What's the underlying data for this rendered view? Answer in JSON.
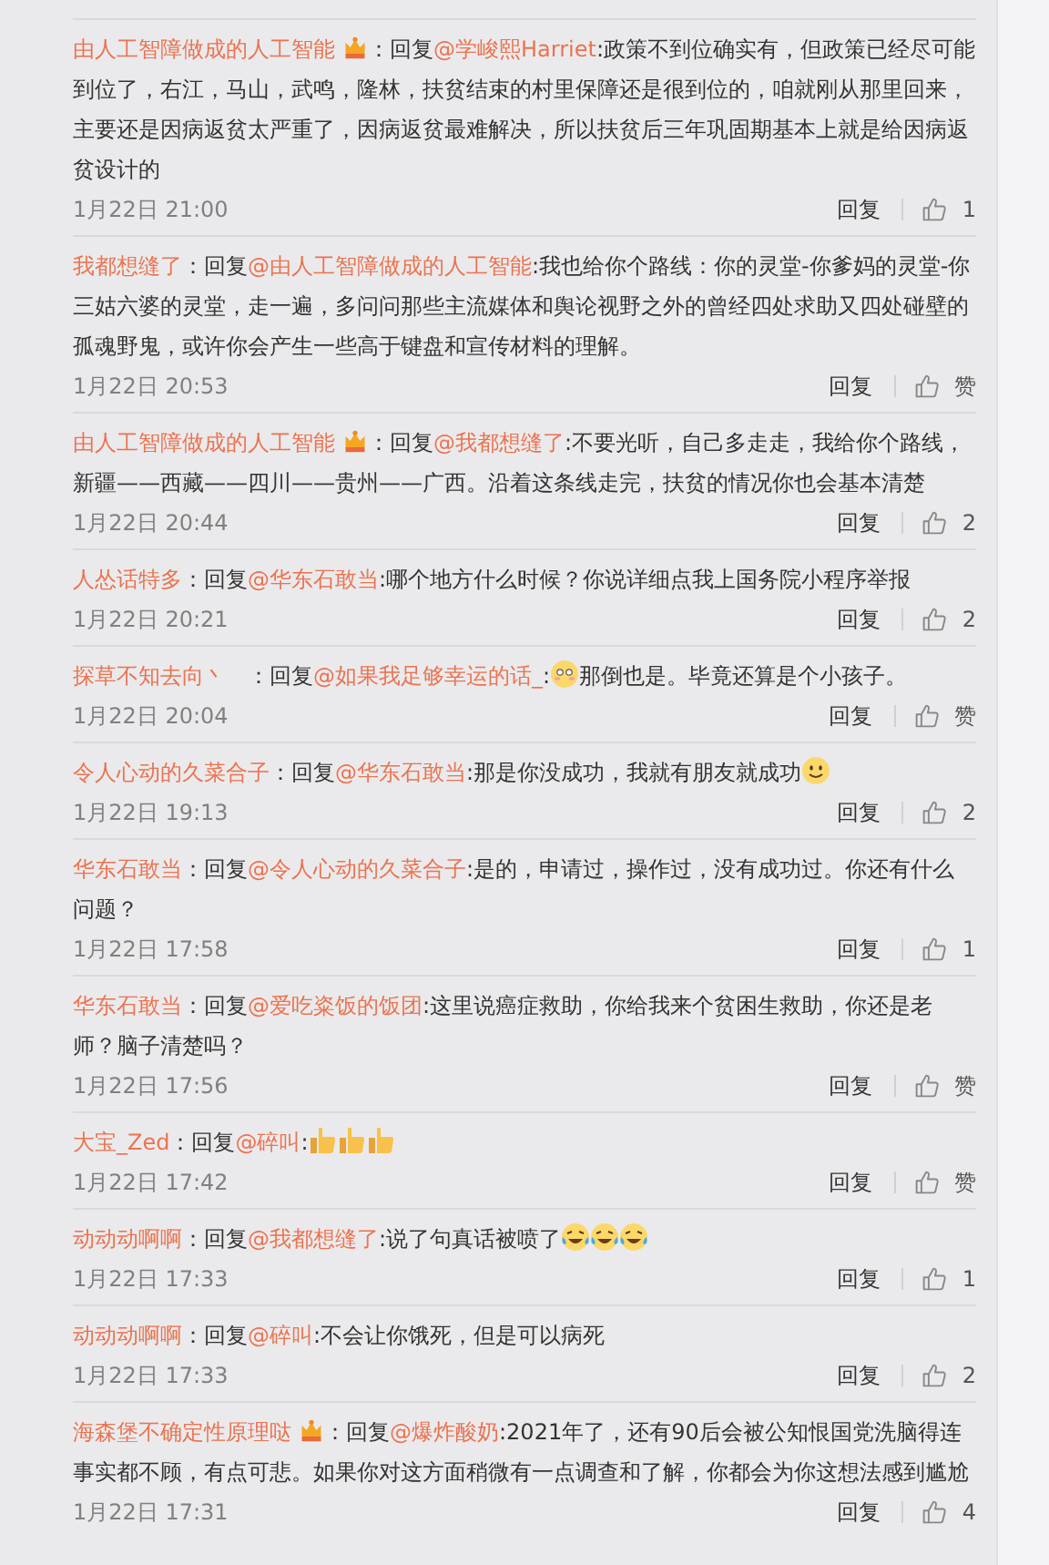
{
  "comments": [
    {
      "user": "由人工智障做成的人工智能",
      "crown_badge": true,
      "reply_label": "：回复",
      "target": "@学峻熙Harriet",
      "body": [
        {
          "kind": "text",
          "text": ":政策不到位确实有，但政策已经尽可能到位了，右江，马山，武鸣，隆林，扶贫结束的村里保障还是很到位的，咱就刚从那里回来，主要还是因病返贫太严重了，因病返贫最难解决，所以扶贫后三年巩固期基本上就是给因病返贫设计的"
        }
      ],
      "time": "1月22日 21:00",
      "reply": "回复",
      "likes": "1"
    },
    {
      "user": "我都想缝了",
      "crown_badge": false,
      "reply_label": "：回复",
      "target": "@由人工智障做成的人工智能",
      "body": [
        {
          "kind": "text",
          "text": ":我也给你个路线：你的灵堂-你爹妈的灵堂-你三姑六婆的灵堂，走一遍，多问问那些主流媒体和舆论视野之外的曾经四处求助又四处碰壁的孤魂野鬼，或许你会产生一些高于键盘和宣传材料的理解。"
        }
      ],
      "time": "1月22日 20:53",
      "reply": "回复",
      "likes": "赞"
    },
    {
      "user": "由人工智障做成的人工智能",
      "crown_badge": true,
      "reply_label": "：回复",
      "target": "@我都想缝了",
      "body": [
        {
          "kind": "text",
          "text": ":不要光听，自己多走走，我给你个路线，新疆——西藏——四川——贵州——广西。沿着这条线走完，扶贫的情况你也会基本清楚"
        }
      ],
      "time": "1月22日 20:44",
      "reply": "回复",
      "likes": "2"
    },
    {
      "user": "人怂话特多",
      "crown_badge": false,
      "reply_label": "：回复",
      "target": "@华东石敢当",
      "body": [
        {
          "kind": "text",
          "text": ":哪个地方什么时候？你说详细点我上国务院小程序举报"
        }
      ],
      "time": "1月22日 20:21",
      "reply": "回复",
      "likes": "2"
    },
    {
      "user": "探草不知去向丶",
      "crown_badge": false,
      "reply_label": "　：回复",
      "target": "@如果我足够幸运的话_",
      "body": [
        {
          "kind": "text",
          "text": ":"
        },
        {
          "kind": "shy"
        },
        {
          "kind": "text",
          "text": "那倒也是。毕竟还算是个小孩子。"
        }
      ],
      "time": "1月22日 20:04",
      "reply": "回复",
      "likes": "赞"
    },
    {
      "user": "令人心动的久菜合子",
      "crown_badge": false,
      "reply_label": "：回复",
      "target": "@华东石敢当",
      "body": [
        {
          "kind": "text",
          "text": ":那是你没成功，我就有朋友就成功"
        },
        {
          "kind": "smile"
        }
      ],
      "time": "1月22日 19:13",
      "reply": "回复",
      "likes": "2"
    },
    {
      "user": "华东石敢当",
      "crown_badge": false,
      "reply_label": "：回复",
      "target": "@令人心动的久菜合子",
      "body": [
        {
          "kind": "text",
          "text": ":是的，申请过，操作过，没有成功过。你还有什么问题？"
        }
      ],
      "time": "1月22日 17:58",
      "reply": "回复",
      "likes": "1"
    },
    {
      "user": "华东石敢当",
      "crown_badge": false,
      "reply_label": "：回复",
      "target": "@爱吃粢饭的饭团",
      "body": [
        {
          "kind": "text",
          "text": ":这里说癌症救助，你给我来个贫困生救助，你还是老师？脑子清楚吗？"
        }
      ],
      "time": "1月22日 17:56",
      "reply": "回复",
      "likes": "赞"
    },
    {
      "user": "大宝_Zed",
      "crown_badge": false,
      "reply_label": "：回复",
      "target": "@碎叫",
      "body": [
        {
          "kind": "text",
          "text": ":"
        },
        {
          "kind": "thumbsup"
        },
        {
          "kind": "thumbsup"
        },
        {
          "kind": "thumbsup"
        }
      ],
      "time": "1月22日 17:42",
      "reply": "回复",
      "likes": "赞"
    },
    {
      "user": "动动动啊啊",
      "crown_badge": false,
      "reply_label": "：回复",
      "target": "@我都想缝了",
      "body": [
        {
          "kind": "text",
          "text": ":说了句真话被喷了"
        },
        {
          "kind": "laughcry"
        },
        {
          "kind": "laughcry"
        },
        {
          "kind": "laughcry"
        }
      ],
      "time": "1月22日 17:33",
      "reply": "回复",
      "likes": "1"
    },
    {
      "user": "动动动啊啊",
      "crown_badge": false,
      "reply_label": "：回复",
      "target": "@碎叫",
      "body": [
        {
          "kind": "text",
          "text": ":不会让你饿死，但是可以病死"
        }
      ],
      "time": "1月22日 17:33",
      "reply": "回复",
      "likes": "2"
    },
    {
      "user": "海森堡不确定性原理哒",
      "crown_badge": true,
      "reply_label": "：回复",
      "target": "@爆炸酸奶",
      "body": [
        {
          "kind": "text",
          "text": ":2021年了，还有90后会被公知恨国党洗脑得连事实都不顾，有点可悲。如果你对这方面稍微有一点调查和了解，你都会为你这想法感到尴尬"
        }
      ],
      "time": "1月22日 17:31",
      "reply": "回复",
      "likes": "4"
    }
  ]
}
